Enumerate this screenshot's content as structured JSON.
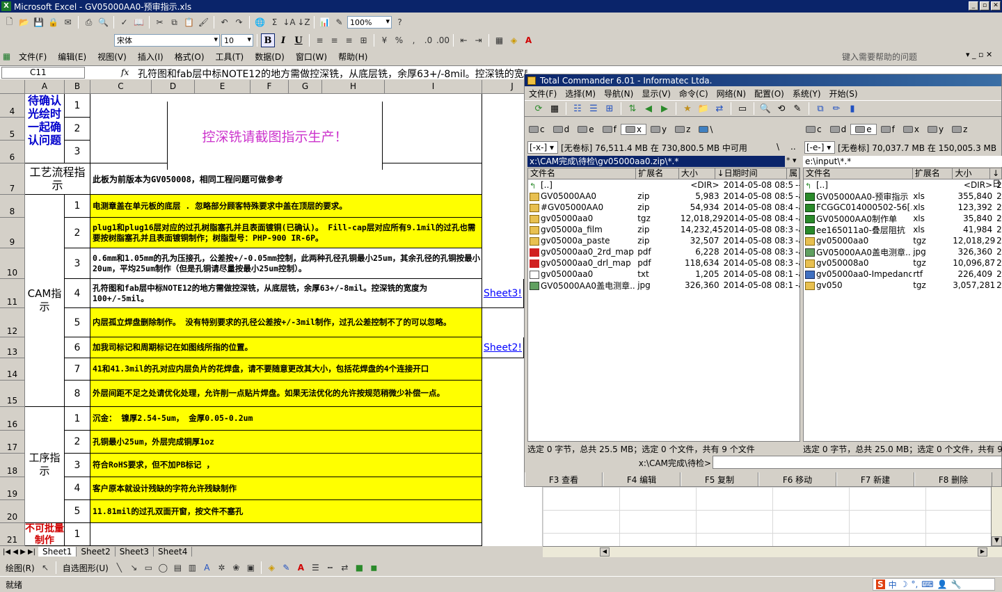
{
  "excel": {
    "title": "Microsoft Excel - GV05000AA0-预审指示.xls",
    "app_icon": "excel-icon",
    "zoom": "100%",
    "font": "宋体",
    "font_size": "10",
    "menus": [
      "文件(F)",
      "编辑(E)",
      "视图(V)",
      "插入(I)",
      "格式(O)",
      "工具(T)",
      "数据(D)",
      "窗口(W)",
      "帮助(H)"
    ],
    "help_placeholder": "键入需要帮助的问题",
    "name_box": "C11",
    "fx": "fx",
    "formula": "孔符图和fab层中标NOTE12的地方需做控深铣，从底层铣，余厚63+/-8mil。控深铣的宽度为 100+/-5mil",
    "columns": [
      "A",
      "B",
      "C",
      "D",
      "E",
      "F",
      "G",
      "H",
      "I",
      "J"
    ],
    "rows": [
      {
        "num": "4",
        "idx": "1"
      },
      {
        "num": "5",
        "idx": "2"
      },
      {
        "num": "6",
        "idx": "3"
      },
      {
        "num": "7"
      },
      {
        "num": "8",
        "idx": "1",
        "text": "电测章盖在单元板的底层 . 忽略部分顾客特殊要求中盖在顶层的要求。"
      },
      {
        "num": "9",
        "idx": "2",
        "text": "plug1和plug16层对应的过孔树脂塞孔并且表面镀铜(已确认)。 Fill-cap层对应所有9.1mil的过孔也需要按树脂塞孔并且表面镀铜制作；树脂型号：PHP-900 IR-6P。"
      },
      {
        "num": "10",
        "idx": "3",
        "text": "0.6mm和1.05mm的孔为压接孔，公差按+/-0.05mm控制，此两种孔径孔铜最小25um，其余孔径的孔铜按最小20um，平均25um制作（但是孔铜请尽量按最小25um控制）。"
      },
      {
        "num": "11",
        "idx": "4",
        "text": "孔符图和fab层中标NOTE12的地方需做控深铣，从底层铣，余厚63+/-8mil。控深铣的宽度为 100+/-5mil。",
        "link": "Sheet3!"
      },
      {
        "num": "12",
        "idx": "5",
        "text": "内层孤立焊盘删除制作。 没有特别要求的孔径公差按+/-3mil制作，过孔公差控制不了的可以忽略。"
      },
      {
        "num": "13",
        "idx": "6",
        "text": "加我司标记和周期标记在如图线所指的位置。",
        "link": "Sheet2!"
      },
      {
        "num": "14",
        "idx": "7",
        "text": "41和41.3mil的孔对应内层负片的花焊盘，请不要随意更改其大小，包括花焊盘的4个连接开口"
      },
      {
        "num": "15",
        "idx": "8",
        "text": "外层间距不足之处请优化处理，允许削一点贴片焊盘。如果无法优化的允许按规范稍微少补偿一点。"
      },
      {
        "num": "16",
        "idx": "1",
        "text": "沉金： 镍厚2.54-5um， 金厚0.05-0.2um"
      },
      {
        "num": "17",
        "idx": "2",
        "text": "孔铜最小25um，外层完成铜厚1oz"
      },
      {
        "num": "18",
        "idx": "3",
        "text": "符合RoHS要求，但不加PB标记 ，"
      },
      {
        "num": "19",
        "idx": "4",
        "text": "客户原本就设计残缺的字符允许残缺制作"
      },
      {
        "num": "20",
        "idx": "5",
        "text": "11.81mil的过孔双面开窗，按文件不塞孔"
      },
      {
        "num": "21",
        "idx": "1"
      }
    ],
    "label_confirm": "待确认光绘时一起确认问题",
    "banner": "控深铣请截图指示生产！",
    "label_process": "工艺流程指示",
    "process_text": "此板为前版本为GV050008，相同工程问题可做参考",
    "label_cam": "CAM指示",
    "label_proc": "工序指示",
    "label_nobatch": "不可批量制作",
    "sheets": [
      "Sheet1",
      "Sheet2",
      "Sheet3",
      "Sheet4"
    ],
    "draw_label": "绘图(R)",
    "autoshape_label": "自选图形(U)",
    "status": "就绪"
  },
  "tc": {
    "title": "Total Commander 6.01 - Informatec Ltda.",
    "menus": [
      "文件(F)",
      "选择(M)",
      "导航(N)",
      "显示(V)",
      "命令(C)",
      "网络(N)",
      "配置(O)",
      "系统(Y)",
      "开始(S)"
    ],
    "drives": [
      "c",
      "d",
      "e",
      "f",
      "x",
      "y",
      "z",
      "\\"
    ],
    "left": {
      "drive": "[-x-]",
      "drive_info": "[无卷标] 76,511.4 MB 在 730,800.5 MB 中可用",
      "path": "x:\\CAM完成\\待检\\gv05000aa0.zip\\*.*",
      "headers": [
        "文件名",
        "扩展名",
        "大小",
        "↓日期时间",
        "属"
      ],
      "files": [
        {
          "name": "[..]",
          "ext": "",
          "size": "<DIR>",
          "date": "2014-05-08 08:50",
          "attr": "---",
          "icon": "up-icon"
        },
        {
          "name": "GV05000AA0",
          "ext": "zip",
          "size": "5,983",
          "date": "2014-05-08 08:50",
          "attr": "-a-",
          "icon": "archive-icon"
        },
        {
          "name": "#GV05000AA0",
          "ext": "zip",
          "size": "54,934",
          "date": "2014-05-08 08:49",
          "attr": "-a-",
          "icon": "archive-icon"
        },
        {
          "name": "gv05000aa0",
          "ext": "tgz",
          "size": "12,018,296",
          "date": "2014-05-08 08:49",
          "attr": "-a-",
          "icon": "archive-icon"
        },
        {
          "name": "gv05000a_film",
          "ext": "zip",
          "size": "14,232,454",
          "date": "2014-05-08 08:39",
          "attr": "-a-",
          "icon": "archive-icon"
        },
        {
          "name": "gv05000a_paste",
          "ext": "zip",
          "size": "32,507",
          "date": "2014-05-08 08:38",
          "attr": "-a-",
          "icon": "archive-icon"
        },
        {
          "name": "gv05000aa0_2rd_map",
          "ext": "pdf",
          "size": "6,228",
          "date": "2014-05-08 08:36",
          "attr": "-a-",
          "icon": "pdf-icon"
        },
        {
          "name": "gv05000aa0_drl_map",
          "ext": "pdf",
          "size": "118,634",
          "date": "2014-05-08 08:36",
          "attr": "-a-",
          "icon": "pdf-icon"
        },
        {
          "name": "gv05000aa0",
          "ext": "txt",
          "size": "1,205",
          "date": "2014-05-08 08:17",
          "attr": "-a-",
          "icon": "text-icon"
        },
        {
          "name": "GV05000AA0盖电测章...",
          "ext": "jpg",
          "size": "326,360",
          "date": "2014-05-08 08:11",
          "attr": "-a-",
          "icon": "image-icon"
        }
      ],
      "status": "选定 0 字节，总共 25.5 MB；选定 0 个文件，共有 9 个文件"
    },
    "right": {
      "drive": "[-e-]",
      "drive_info": "[无卷标] 70,037.7 MB 在 150,005.3 MB",
      "path": "e:\\input\\*.*",
      "headers": [
        "文件名",
        "扩展名",
        "大小",
        "↓日"
      ],
      "files": [
        {
          "name": "[..]",
          "ext": "",
          "size": "<DIR>",
          "date": "20",
          "icon": "up-icon"
        },
        {
          "name": "GV05000AA0-预审指示",
          "ext": "xls",
          "size": "355,840",
          "date": "20",
          "icon": "excel-file-icon"
        },
        {
          "name": "FCGGC014000502-56[...",
          "ext": "xls",
          "size": "123,392",
          "date": "20",
          "icon": "excel-file-icon"
        },
        {
          "name": "GV05000AA0制作单",
          "ext": "xls",
          "size": "35,840",
          "date": "20",
          "icon": "excel-file-icon"
        },
        {
          "name": "ee165011a0-叠层阻抗",
          "ext": "xls",
          "size": "41,984",
          "date": "20",
          "icon": "excel-file-icon"
        },
        {
          "name": "gv05000aa0",
          "ext": "tgz",
          "size": "12,018,296",
          "date": "20",
          "icon": "archive-icon"
        },
        {
          "name": "GV05000AA0盖电测章...",
          "ext": "jpg",
          "size": "326,360",
          "date": "20",
          "icon": "image-icon"
        },
        {
          "name": "gv050008a0",
          "ext": "tgz",
          "size": "10,096,878",
          "date": "20",
          "icon": "archive-icon"
        },
        {
          "name": "gv05000aa0-Impedanc...",
          "ext": "rtf",
          "size": "226,409",
          "date": "20",
          "icon": "doc-icon"
        },
        {
          "name": "gv050",
          "ext": "tgz",
          "size": "3,057,281",
          "date": "20",
          "icon": "archive-icon"
        }
      ],
      "status": "选定 0 字节，总共 25.0 MB；选定 0 个文件，共有 9"
    },
    "cmd_prompt": "x:\\CAM完成\\待检>",
    "fkeys": [
      "F3 查看",
      "F4 编辑",
      "F5 复制",
      "F6 移动",
      "F7 新建",
      "F8 删除"
    ]
  }
}
